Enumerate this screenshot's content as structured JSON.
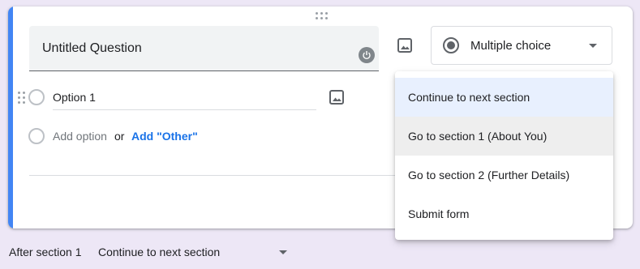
{
  "question": {
    "title": "Untitled Question",
    "type_label": "Multiple choice",
    "options": [
      {
        "label": "Option 1"
      }
    ],
    "add_option_label": "Add option",
    "or_label": "or",
    "add_other_label": "Add \"Other\""
  },
  "section_footer": {
    "label": "After section 1",
    "value": "Continue to next section"
  },
  "dropdown_menu": {
    "items": [
      {
        "label": "Continue to next section",
        "state": "selected"
      },
      {
        "label": "Go to section 1 (About You)",
        "state": "hover"
      },
      {
        "label": "Go to section 2 (Further Details)",
        "state": "normal"
      },
      {
        "label": "Submit form",
        "state": "normal"
      }
    ]
  },
  "colors": {
    "background": "#ede7f6",
    "accent": "#4285f4",
    "link": "#1a73e8",
    "selected_item": "#e8f0fe",
    "hover_item": "#eeeeee"
  },
  "icons": [
    "drag-handle-icon",
    "power-icon",
    "image-icon",
    "radio-selected-icon",
    "chevron-down-icon"
  ]
}
